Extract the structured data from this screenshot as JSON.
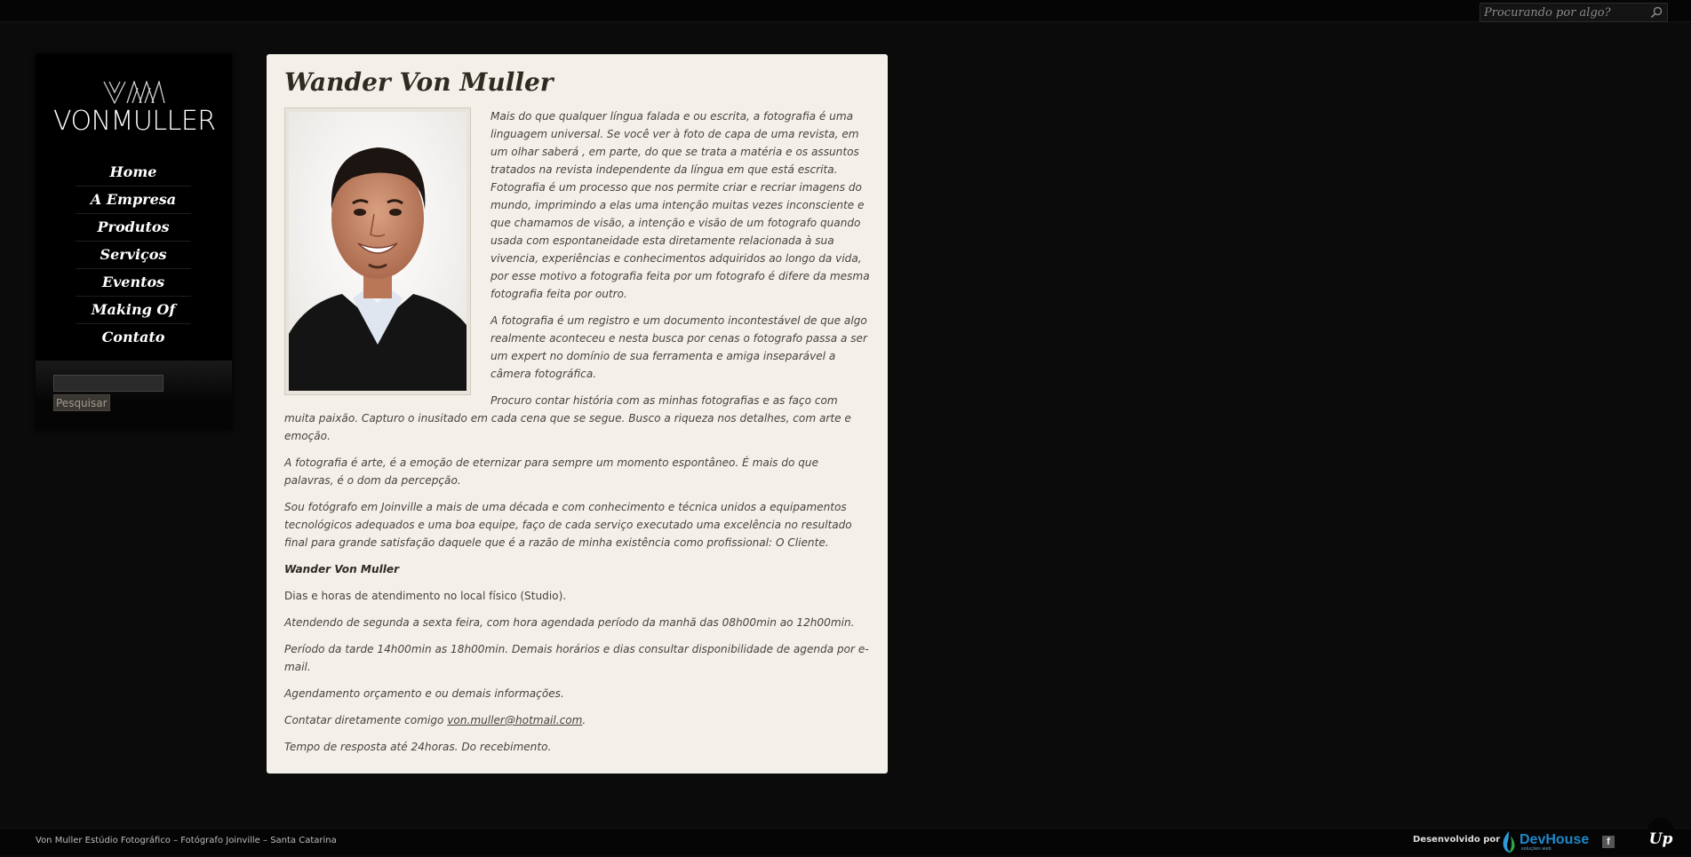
{
  "header": {
    "search_placeholder": "Procurando por algo?"
  },
  "sidebar": {
    "logo_text": "VONMULLER",
    "nav": [
      {
        "label": "Home"
      },
      {
        "label": "A Empresa"
      },
      {
        "label": "Produtos"
      },
      {
        "label": "Serviços"
      },
      {
        "label": "Eventos"
      },
      {
        "label": "Making Of"
      },
      {
        "label": "Contato"
      }
    ],
    "search_button": "Pesquisar"
  },
  "page": {
    "title": "Wander Von Muller",
    "paragraphs": [
      "Mais do que qualquer língua falada e ou escrita, a fotografia é uma linguagem universal. Se você ver à foto de capa de uma revista, em um  olhar saberá , em parte, do que se trata a matéria e os assuntos tratados na revista independente da língua em que está escrita. Fotografia é um processo que nos permite criar e recriar imagens do mundo, imprimindo a elas uma intenção muitas vezes inconsciente e que chamamos de visão, a intenção e visão de um fotografo quando usada com espontaneidade esta diretamente relacionada à sua vivencia, experiências e conhecimentos adquiridos ao longo da vida, por esse motivo a fotografia feita por um fotografo é difere da mesma fotografia feita por outro.",
      "A fotografia é um registro e um documento incontestável de que algo realmente aconteceu e nesta busca por cenas o fotografo passa a ser um expert no domínio de sua  ferramenta e amiga inseparável a câmera fotográfica.",
      "Procuro contar história com as minhas fotografias e as faço com muita paixão. Capturo o inusitado em cada cena que se segue. Busco a riqueza nos detalhes, com arte e emoção.",
      "A fotografia é arte, é a emoção de eternizar para sempre um momento espontâneo. É mais do que palavras, é o dom da percepção.",
      "Sou fotógrafo em Joinville a mais de uma década e com conhecimento e técnica unidos a equipamentos tecnológicos adequados e uma boa equipe, faço de cada serviço executado uma excelência no resultado final para grande satisfação daquele que é a razão de minha existência como profissional: O Cliente."
    ],
    "signature": "Wander Von Muller",
    "hours_intro": "Dias e horas de atendimento no local físico (Studio).",
    "morning": "Atendendo de segunda a sexta feira, com hora agendada período da manhã das 08h00min ao 12h00min.",
    "afternoon": "Período da tarde 14h00min as 18h00min. Demais horários e dias consultar disponibilidade de agenda por e-mail.",
    "booking": "Agendamento orçamento e ou demais informações.",
    "contact_prefix": "Contatar diretamente comigo ",
    "contact_email": "von.muller@hotmail.com",
    "contact_suffix": ".",
    "response_time": "Tempo de resposta até 24horas. Do recebimento."
  },
  "footer": {
    "text": "Von Muller Estúdio Fotográfico – Fotógrafo Joinville – Santa Catarina",
    "developed_by": "Desenvolvido por",
    "dev_brand": "DevHouse",
    "dev_tagline": "soluções web",
    "facebook_glyph": "f",
    "up_label": "Up"
  },
  "colors": {
    "page_bg": "#0b0b0b",
    "content_bg": "#f3f0e9",
    "devhouse_blue": "#1e88c9"
  },
  "icons": [
    "search-icon",
    "logo-mark-icon",
    "devhouse-logo-icon",
    "facebook-icon"
  ]
}
